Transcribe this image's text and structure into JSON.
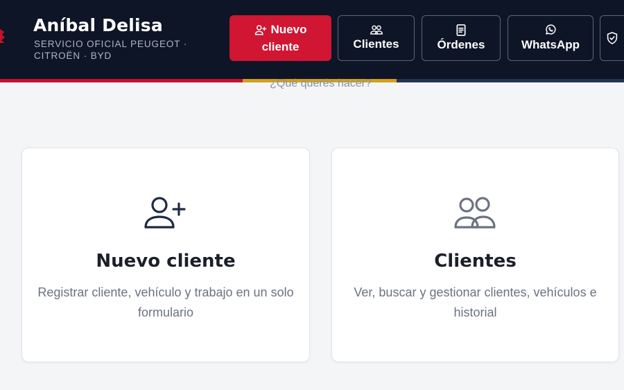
{
  "brand": {
    "title": "Aníbal Delisa",
    "subtitle": "SERVICIO OFICIAL PEUGEOT · CITROËN · BYD",
    "accent": "#c8102e",
    "stripe_colors": [
      "#c8102e",
      "#d4a017",
      "#233452"
    ]
  },
  "nav": {
    "nuevo_cliente": {
      "line1": "Nuevo",
      "line2": "cliente",
      "icon": "user-plus-icon"
    },
    "clientes": {
      "label": "Clientes",
      "icon": "users-icon"
    },
    "ordenes": {
      "label": "Órdenes",
      "icon": "document-icon"
    },
    "whatsapp": {
      "label": "WhatsApp",
      "icon": "whatsapp-icon"
    },
    "security": {
      "icon": "shield-check-icon"
    }
  },
  "main": {
    "prompt": "¿Qué querés hacer?",
    "cards": [
      {
        "title": "Nuevo cliente",
        "description": "Registrar cliente, vehículo y trabajo en un solo formulario",
        "icon": "user-plus-icon"
      },
      {
        "title": "Clientes",
        "description": "Ver, buscar y gestionar clientes, vehículos e historial",
        "icon": "users-icon"
      }
    ]
  }
}
